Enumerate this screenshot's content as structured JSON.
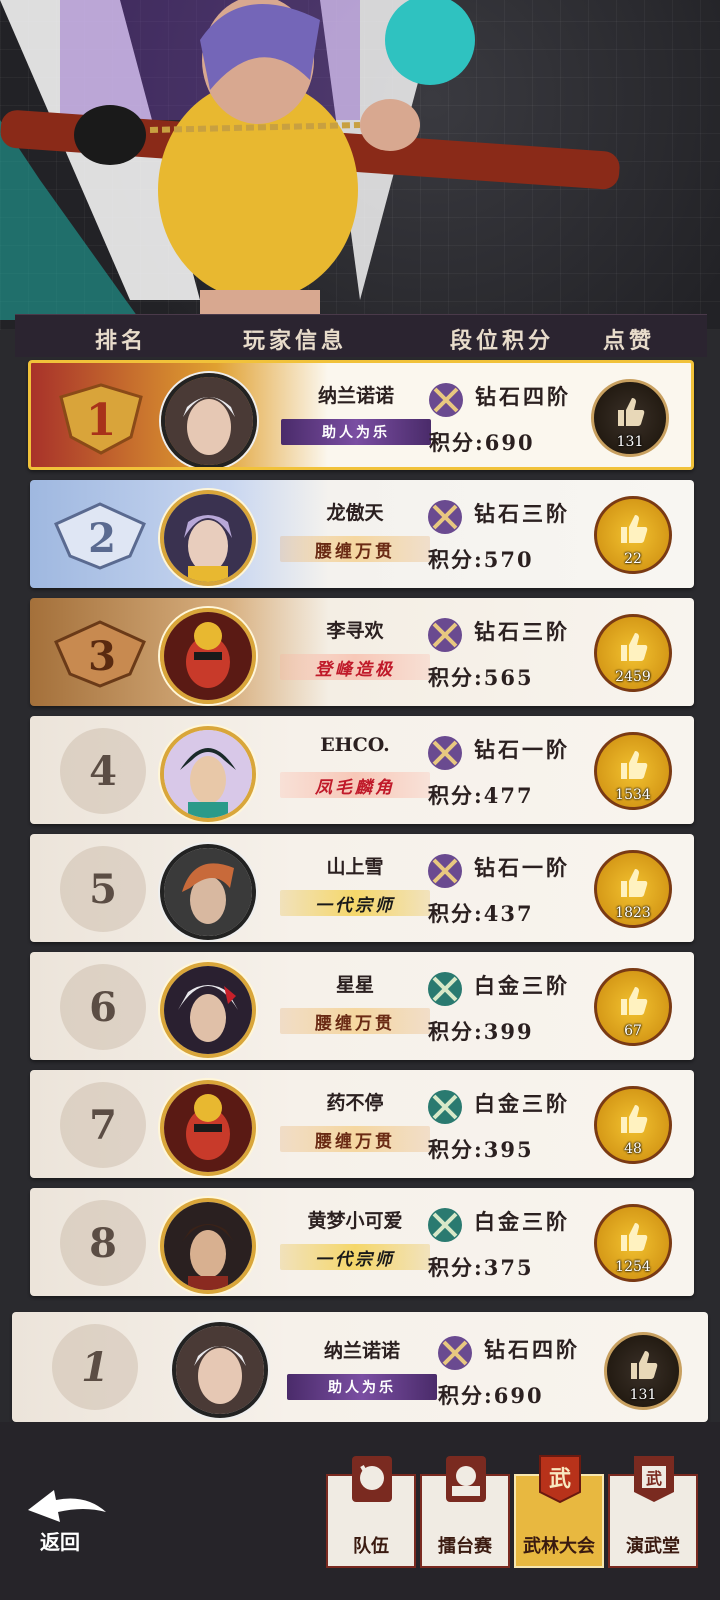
{
  "header": {
    "col_rank": "排名",
    "col_player": "玩家信息",
    "col_tier": "段位积分",
    "col_like": "点赞"
  },
  "rows": [
    {
      "rank": "1",
      "name": "纳兰诺诺",
      "title": "助人为乐",
      "title_style": "purple",
      "tier": "钻石四阶",
      "score": "积分:690",
      "likes": "131"
    },
    {
      "rank": "2",
      "name": "龙傲天",
      "title": "腰缠万贯",
      "title_style": "gold",
      "tier": "钻石三阶",
      "score": "积分:570",
      "likes": "22"
    },
    {
      "rank": "3",
      "name": "李寻欢",
      "title": "登峰造极",
      "title_style": "red",
      "tier": "钻石三阶",
      "score": "积分:565",
      "likes": "2459"
    },
    {
      "rank": "4",
      "name": "EHCO.",
      "title": "凤毛麟角",
      "title_style": "red",
      "tier": "钻石一阶",
      "score": "积分:477",
      "likes": "1534"
    },
    {
      "rank": "5",
      "name": "山上雪",
      "title": "一代宗师",
      "title_style": "black",
      "tier": "钻石一阶",
      "score": "积分:437",
      "likes": "1823"
    },
    {
      "rank": "6",
      "name": "星星",
      "title": "腰缠万贯",
      "title_style": "gold",
      "tier": "白金三阶",
      "score": "积分:399",
      "likes": "67"
    },
    {
      "rank": "7",
      "name": "药不停",
      "title": "腰缠万贯",
      "title_style": "gold",
      "tier": "白金三阶",
      "score": "积分:395",
      "likes": "48"
    },
    {
      "rank": "8",
      "name": "黄梦小可爱",
      "title": "一代宗师",
      "title_style": "black",
      "tier": "白金三阶",
      "score": "积分:375",
      "likes": "1254"
    }
  ],
  "self_row": {
    "rank": "1",
    "name": "纳兰诺诺",
    "title": "助人为乐",
    "tier": "钻石四阶",
    "score": "积分:690",
    "likes": "131"
  },
  "nav": {
    "back": "返回",
    "team": "队伍",
    "arena": "擂台赛",
    "wulin": "武林大会",
    "hall": "演武堂",
    "active": "武林大会",
    "wu_char": "武"
  },
  "colors": {
    "gold": "#f1c23a",
    "dark_bg": "#262429",
    "diamond": "#7a5aa0",
    "platinum": "#3a8a80"
  }
}
